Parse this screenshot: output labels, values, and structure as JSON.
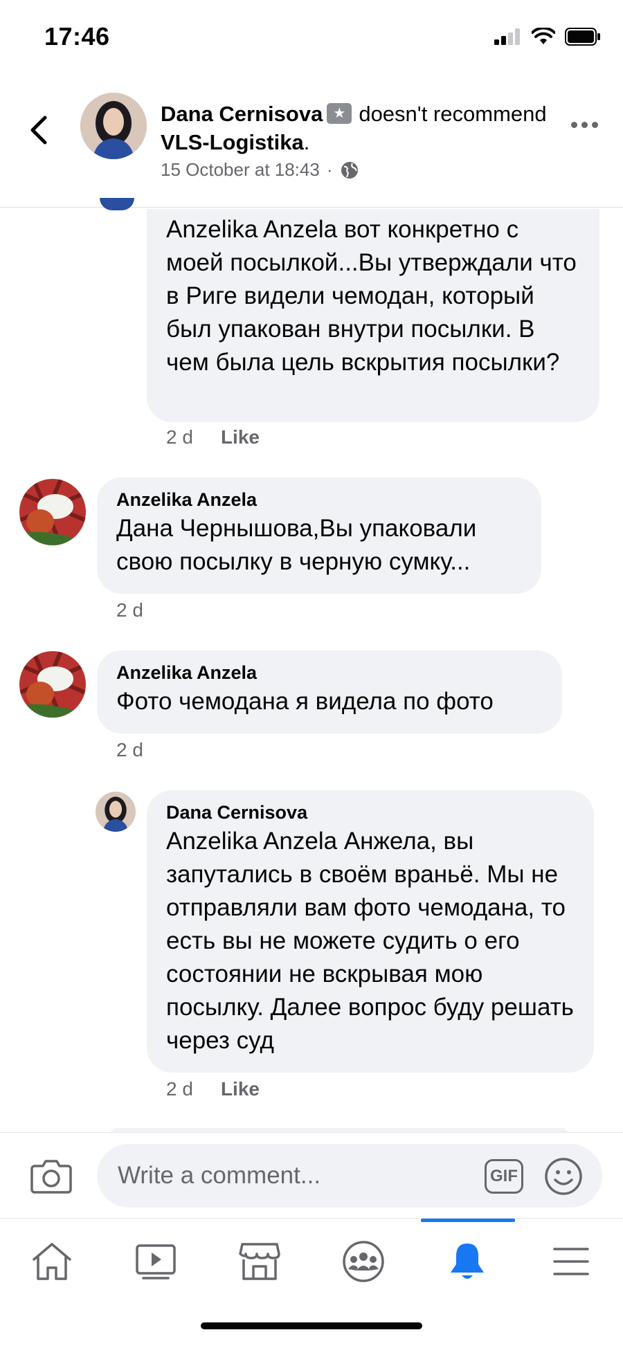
{
  "status_bar": {
    "time": "17:46",
    "icons": [
      "signal-icon",
      "wifi-icon",
      "battery-icon"
    ]
  },
  "header": {
    "author": "Dana Cernisova",
    "badge_icon": "star-badge-icon",
    "action_text": "doesn't recommend",
    "page_name": "VLS-Logistika",
    "period": ".",
    "timestamp": "15 October at 18:43",
    "separator": "·",
    "privacy_icon": "globe-icon"
  },
  "comments": [
    {
      "name": "",
      "text": "Anzelika Anzela вот конкретно с моей посылкой...Вы утверждали что в Риге видели чемодан, который был упакован внутри посылки. В чем была цель вскрытия посылки?",
      "age": "2 d",
      "like": "Like"
    },
    {
      "name": "Anzelika Anzela",
      "text": "Дана Чернышова,Вы упаковали свою посылку в черную сумку...",
      "age": "2 d"
    },
    {
      "name": "Anzelika Anzela",
      "text": "Фото чемодана я видела  по фото",
      "age": "2 d"
    },
    {
      "name": "Dana Cernisova",
      "text": "Anzelika Anzela Анжела, вы запутались в своём враньё. Мы не отправляли вам фото чемодана, то есть вы не можете судить о его состоянии не вскрывая мою посылку. Далее вопрос буду решать через суд",
      "age": "2 d",
      "like": "Like"
    }
  ],
  "composer": {
    "placeholder": "Write a comment...",
    "gif_label": "GIF",
    "camera_icon": "camera-icon",
    "emoji_icon": "emoji-icon"
  },
  "tabbar": {
    "tabs": [
      "home-icon",
      "video-icon",
      "marketplace-icon",
      "groups-icon",
      "notifications-icon",
      "menu-icon"
    ],
    "active": "notifications-icon",
    "active_color": "#1877f2"
  },
  "colors": {
    "bubble": "#f0f2f5",
    "secondary_text": "#65676b",
    "accent": "#1877f2"
  }
}
